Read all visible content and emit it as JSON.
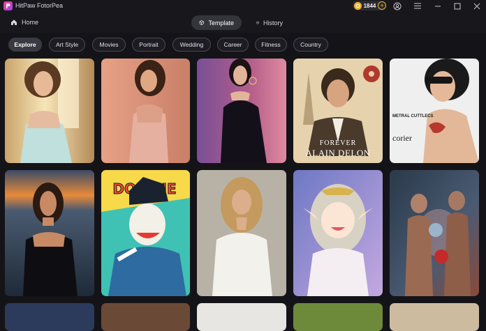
{
  "app": {
    "title": "HitPaw FotorPea"
  },
  "titlebar": {
    "coins": "1844",
    "icons": [
      "coin-icon",
      "add-coin-icon",
      "user-icon",
      "menu-icon",
      "minimize-icon",
      "maximize-icon",
      "close-icon"
    ]
  },
  "nav": {
    "home_label": "Home",
    "tabs": [
      {
        "label": "Template",
        "icon": "cube-icon"
      },
      {
        "label": "History",
        "icon": "history-icon"
      }
    ]
  },
  "filters": [
    {
      "label": "Explore",
      "active": true
    },
    {
      "label": "Art Style"
    },
    {
      "label": "Movies"
    },
    {
      "label": "Portrait"
    },
    {
      "label": "Wedding"
    },
    {
      "label": "Career"
    },
    {
      "label": "Fitness"
    },
    {
      "label": "Country"
    }
  ],
  "templates": {
    "row1": [
      {
        "name": "woman-white-dress-window"
      },
      {
        "name": "woman-pink-dress"
      },
      {
        "name": "woman-black-dress-hoops"
      },
      {
        "name": "alain-delon-poster",
        "text_line1": "FOREVER",
        "text_line2": "ALAIN DELON"
      },
      {
        "name": "magazine-cover-tattoo",
        "headline": "METRAL CUTTLECS",
        "sub": "corier"
      }
    ],
    "row2": [
      {
        "name": "woman-sunset-beach"
      },
      {
        "name": "comic-joker",
        "banner": "DOMINE"
      },
      {
        "name": "woman-white-blouse"
      },
      {
        "name": "anime-elf-girl"
      },
      {
        "name": "boxers-fight"
      }
    ]
  },
  "colors": {
    "accent_coin": "#f3b22a",
    "chip_active": "#3a3a42",
    "background": "#141418"
  }
}
